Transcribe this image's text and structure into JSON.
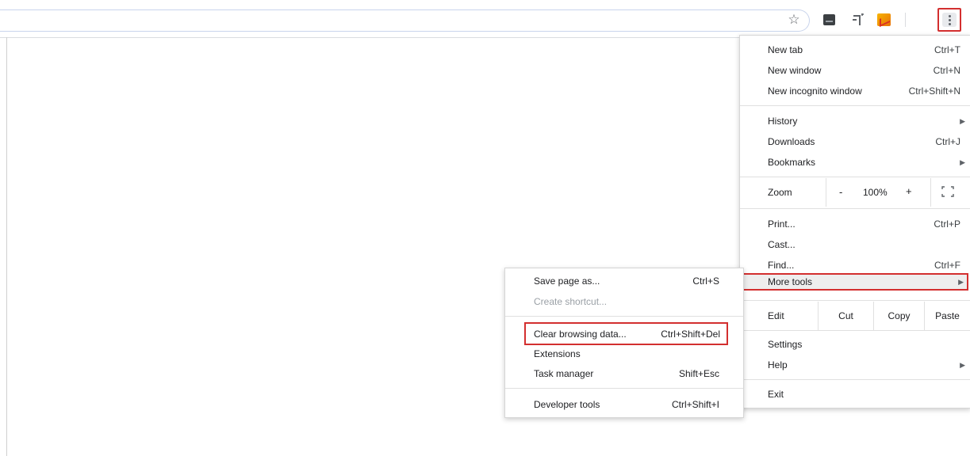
{
  "toolbar": {
    "star_icon": "star-icon",
    "extensions": [
      "extension-dark-icon",
      "extension-arrow-icon",
      "extension-chart-icon"
    ],
    "menu_icon": "three-dots-vertical-icon"
  },
  "main_menu": {
    "new_tab": {
      "label": "New tab",
      "shortcut": "Ctrl+T"
    },
    "new_window": {
      "label": "New window",
      "shortcut": "Ctrl+N"
    },
    "new_incognito": {
      "label": "New incognito window",
      "shortcut": "Ctrl+Shift+N"
    },
    "history": {
      "label": "History"
    },
    "downloads": {
      "label": "Downloads",
      "shortcut": "Ctrl+J"
    },
    "bookmarks": {
      "label": "Bookmarks"
    },
    "zoom": {
      "label": "Zoom",
      "minus": "-",
      "value": "100%",
      "plus": "+"
    },
    "print": {
      "label": "Print...",
      "shortcut": "Ctrl+P"
    },
    "cast": {
      "label": "Cast..."
    },
    "find": {
      "label": "Find...",
      "shortcut": "Ctrl+F"
    },
    "more_tools": {
      "label": "More tools"
    },
    "edit": {
      "label": "Edit",
      "cut": "Cut",
      "copy": "Copy",
      "paste": "Paste"
    },
    "settings": {
      "label": "Settings"
    },
    "help": {
      "label": "Help"
    },
    "exit": {
      "label": "Exit"
    }
  },
  "more_tools_menu": {
    "save_page": {
      "label": "Save page as...",
      "shortcut": "Ctrl+S"
    },
    "create_shortcut": {
      "label": "Create shortcut..."
    },
    "clear_browsing": {
      "label": "Clear browsing data...",
      "shortcut": "Ctrl+Shift+Del"
    },
    "extensions": {
      "label": "Extensions"
    },
    "task_manager": {
      "label": "Task manager",
      "shortcut": "Shift+Esc"
    },
    "developer_tools": {
      "label": "Developer tools",
      "shortcut": "Ctrl+Shift+I"
    }
  },
  "colors": {
    "highlight": "#d32f2f",
    "hover": "#eeeeee"
  }
}
